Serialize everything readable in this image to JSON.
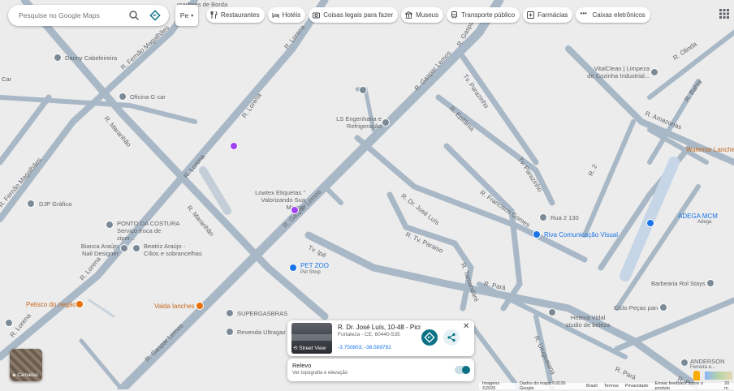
{
  "search": {
    "placeholder": "Pesquise no Google Maps"
  },
  "language_button": {
    "label": "Pe"
  },
  "chips": [
    {
      "label": "Restaurantes",
      "icon": "fork-knife-icon"
    },
    {
      "label": "Hotéis",
      "icon": "bed-icon"
    },
    {
      "label": "Coisas legais para fazer",
      "icon": "camera-icon"
    },
    {
      "label": "Museus",
      "icon": "museum-icon"
    },
    {
      "label": "Transporte público",
      "icon": "train-icon"
    },
    {
      "label": "Farmácias",
      "icon": "pharmacy-icon"
    },
    {
      "label": "Caixas eletrônicos",
      "icon": "more-icon"
    }
  ],
  "streets": {
    "fernao_magalhaes": "R. Fernão Magalhães",
    "lorena_top": "R. Lorena",
    "lorena_mid": "R. Lorena",
    "lorena_left": "R. Lorena",
    "lorena_bottom": "R. Lorena",
    "lorena_center": "R. Lorena",
    "maranhao_top": "R. Maranhão",
    "maranhao_mid": "R. Maranhão",
    "gaspar_lemos_top": "R. Gaspar Lemos",
    "gaspar_lemos_top2": "R. Gaspar",
    "gaspar_lemos_mid": "R. Gaspar Lemos",
    "gaspar_lemos_bottom": "R. Gaspar Lemos",
    "parazinho_top": "Tv. Parazinho",
    "parazinho_mid": "Tv. Parazinho",
    "epifania": "R. Epifânia",
    "dr_jose_luis": "R. Dr. José Luís",
    "tv_paraiso": "R. Tv. Paraiso",
    "francisco_gomes": "R. Francisco Gomes",
    "tv_ipe": "Tv. Ipê",
    "tamandare": "R. Tamandaré",
    "para_1": "R. Pará",
    "para_2": "R. Pará",
    "para_3": "R. Pará",
    "uruguaiana": "R. Uruguaiana",
    "amazonas": "R. Amazonas",
    "bahia": "R. Bahia",
    "olinda": "R. Olinda",
    "r2": "R. 2",
    "magalhaes_left": "R. Fernão Magalhães"
  },
  "pois": {
    "top_cut": "oradores de Borda",
    "car": "Car",
    "danny": "Danny Cabeleireira",
    "oficina": "Oficina G car",
    "ls_engenharia": "LS Engenharia e Refrigeração",
    "lowtex": "Lowtex Etiquetas \" Valorizando Sua Marca\"",
    "djp": "DJP Gráfica",
    "ponto_costura": "PONTO DA COSTURA Serviço troca de ziper...",
    "bianca": "Bianca Araújo Nail Designer",
    "beatriz": "Beatriz Araújo - Cílios e sobrancelhas",
    "pet_zoo": "PET ZOO",
    "pet_zoo_sub": "Pet Shop",
    "petisco": "Petisco do negão",
    "valda": "Valda lanches",
    "supergasbras": "SUPERGASBRAS",
    "revenda": "Revenda Ultragaz",
    "vitalclean": "VitalClean | Limpeza de Cozinha Industrial...",
    "walemar": "Walemar Lanches",
    "adega": "ADEGA MCM",
    "adega_sub": "Adega",
    "rua2130": "Rua 2 130",
    "riva": "Riva Comunicação Visual",
    "barbearia": "Barbearia Rol Stays",
    "ciclo": "Ciclo Peças pan",
    "helena": "Helena Vidal studio de beleza",
    "anderson": "ANDERSON",
    "anderson_sub": "Ferreira e..."
  },
  "info_card": {
    "title": "R. Dr. José Luís, 10-48 - Pici",
    "subtitle": "Fortaleza - CE, 60440-535",
    "coords": "-3.750803, -38.569792",
    "streetview_label": "Street View"
  },
  "relief": {
    "title": "Relevo",
    "subtitle": "Ver topografia e elevação"
  },
  "layers": {
    "label": "Camadas"
  },
  "footer": [
    "Imagens ©2026",
    "Dados do mapa ©2026 Google",
    "Brasil",
    "Termos",
    "Privacidade",
    "Enviar feedback sobre o produto",
    "20 m"
  ],
  "colors": {
    "road": "#aab9c8",
    "land": "#ececec",
    "accent": "#0b7285"
  }
}
